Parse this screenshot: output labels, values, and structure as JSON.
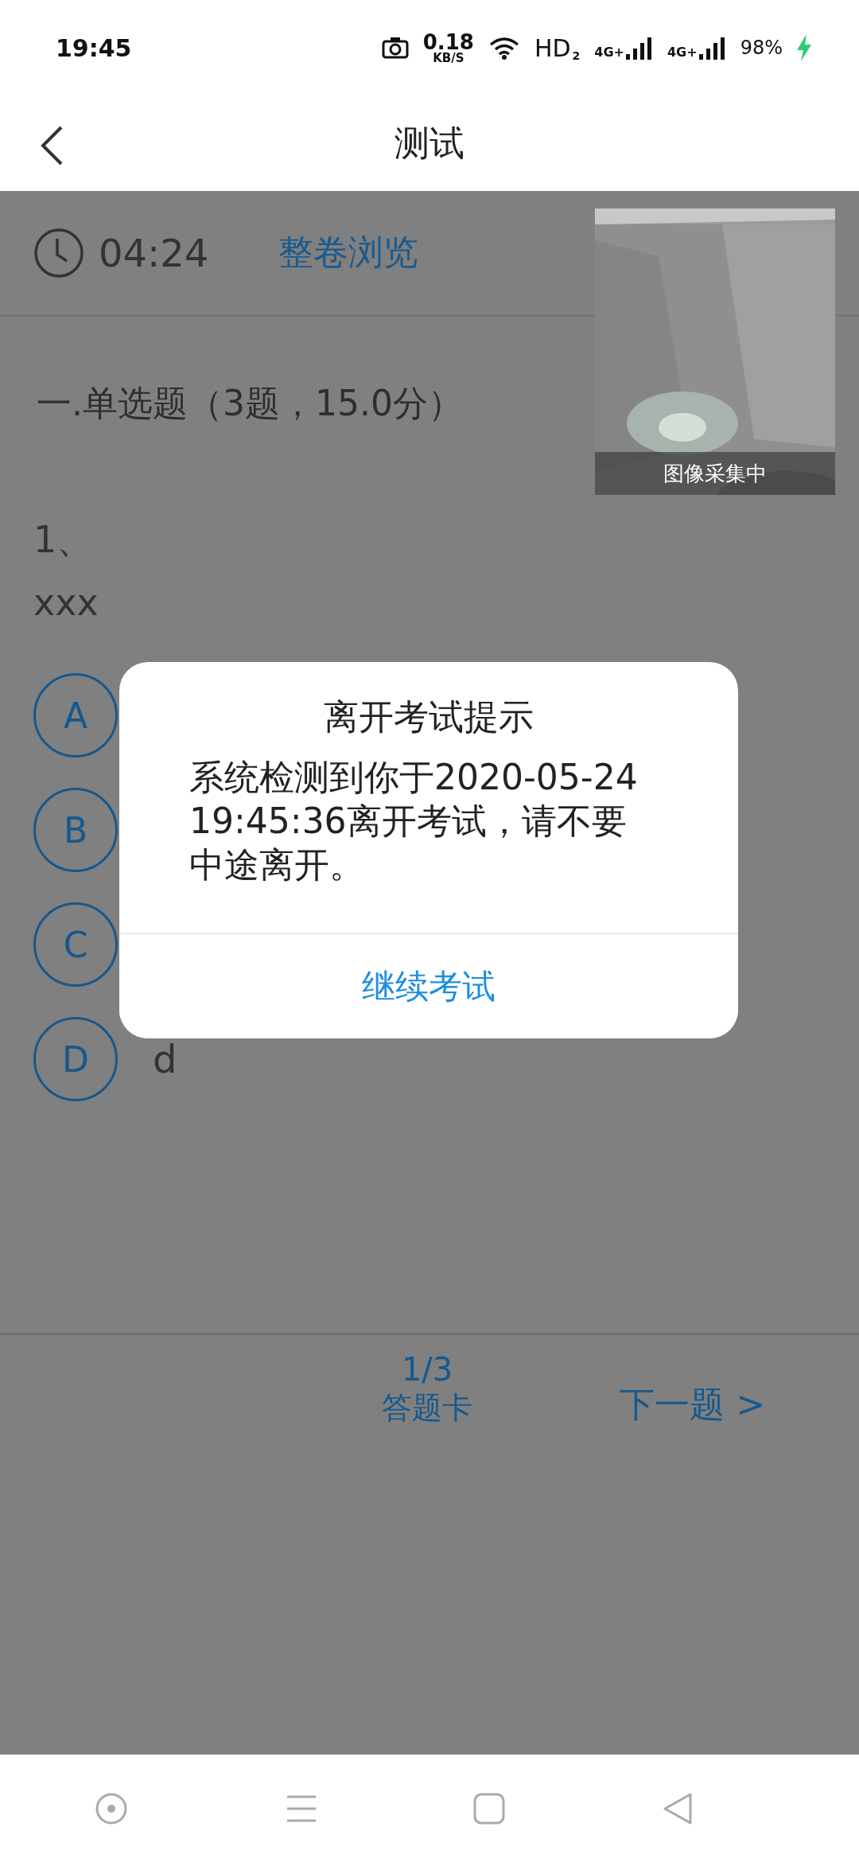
{
  "status_bar": {
    "time": "19:45",
    "speed": "0.18",
    "speed_unit": "KB/S",
    "hd": "HD",
    "sim_index": "2",
    "networks": [
      "4G+",
      "4G+"
    ],
    "battery": "98%",
    "charging": true
  },
  "header": {
    "title": "测试"
  },
  "timer": {
    "time": "04:24",
    "overview": "整卷浏览"
  },
  "camera": {
    "caption": "图像采集中"
  },
  "section": {
    "title": "一.单选题（3题，15.0分）"
  },
  "question": {
    "number": "1、",
    "text": "xxx"
  },
  "options": [
    {
      "letter": "A"
    },
    {
      "letter": "B"
    },
    {
      "letter": "C"
    },
    {
      "letter": "D",
      "text": "d"
    }
  ],
  "footer": {
    "progress": "1/3",
    "answer_card": "答题卡",
    "next": "下一题 >"
  },
  "dialog": {
    "title": "离开考试提示",
    "message": "系统检测到你于2020-05-24 19:45:36离开考试，请不要中途离开。",
    "button": "继续考试"
  }
}
